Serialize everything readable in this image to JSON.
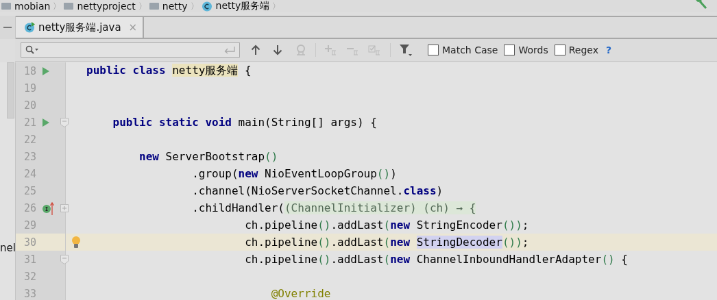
{
  "breadcrumbs": [
    {
      "label": "mobian",
      "kind": "folder",
      "separator": "〉"
    },
    {
      "label": "nettyproject",
      "kind": "folder",
      "separator": "〉"
    },
    {
      "label": "netty",
      "kind": "folder",
      "separator": "〉"
    },
    {
      "label": "netty服务端",
      "kind": "class",
      "separator": "〉"
    }
  ],
  "side_panel_text": "nel",
  "tabs": [
    {
      "label": "netty服务端.java",
      "selected": true,
      "close": "×"
    }
  ],
  "find_bar": {
    "options": [
      {
        "label": "Match Case",
        "checked": false
      },
      {
        "label": "Words",
        "checked": false
      },
      {
        "label": "Regex",
        "checked": false
      }
    ],
    "help": "?"
  },
  "editor": {
    "lines": [
      {
        "number": "18",
        "gutter_icons": [
          {
            "kind": "run"
          }
        ],
        "current": false,
        "segments": [
          {
            "text": "public class ",
            "kind": "kw"
          },
          {
            "text": "netty服务端",
            "kind": "hl"
          },
          {
            "text": " {",
            "kind": "text"
          }
        ]
      },
      {
        "number": "19",
        "current": false
      },
      {
        "number": "20",
        "current": false
      },
      {
        "number": "21",
        "gutter_icons": [
          {
            "kind": "run"
          },
          {
            "kind": "fold"
          }
        ],
        "current": false,
        "segments": [
          {
            "text": "    public static void ",
            "kind": "kw"
          },
          {
            "text": "main(String[] args) {",
            "kind": "text"
          }
        ]
      },
      {
        "number": "22",
        "current": false
      },
      {
        "number": "23",
        "current": false,
        "segments": [
          {
            "text": "        new ",
            "kind": "kw"
          },
          {
            "text": "ServerBootstrap",
            "kind": "text"
          },
          {
            "text": "()",
            "kind": "paren"
          }
        ]
      },
      {
        "number": "24",
        "current": false,
        "segments": [
          {
            "text": "                .group(",
            "kind": "text"
          },
          {
            "text": "new ",
            "kind": "kw"
          },
          {
            "text": "NioEventLoopGroup",
            "kind": "text"
          },
          {
            "text": "()",
            "kind": "paren"
          },
          {
            "text": ")",
            "kind": "text"
          }
        ]
      },
      {
        "number": "25",
        "current": false,
        "segments": [
          {
            "text": "                .channel(NioServerSocketChannel.",
            "kind": "text"
          },
          {
            "text": "class",
            "kind": "kw"
          },
          {
            "text": ")",
            "kind": "text"
          }
        ]
      },
      {
        "number": "26",
        "gutter_icons": [
          {
            "kind": "implement"
          },
          {
            "kind": "expand"
          }
        ],
        "current": false,
        "segments": [
          {
            "text": "                .childHandler(",
            "kind": "text"
          },
          {
            "text": "(ChannelInitializer) (ch) → {",
            "kind": "folded"
          }
        ]
      },
      {
        "number": "29",
        "current": false,
        "segments": [
          {
            "text": "                        ch.pipeline",
            "kind": "text"
          },
          {
            "text": "()",
            "kind": "paren"
          },
          {
            "text": ".addLast",
            "kind": "text"
          },
          {
            "text": "(",
            "kind": "paren"
          },
          {
            "text": "new ",
            "kind": "kw"
          },
          {
            "text": "StringEncoder",
            "kind": "text"
          },
          {
            "text": "())",
            "kind": "paren"
          },
          {
            "text": ";",
            "kind": "text"
          }
        ]
      },
      {
        "number": "30",
        "gutter_icons": [
          {
            "kind": "bulb"
          }
        ],
        "current": true,
        "segments": [
          {
            "text": "                        ch.pipeline",
            "kind": "text"
          },
          {
            "text": "()",
            "kind": "paren"
          },
          {
            "text": ".addLast",
            "kind": "text"
          },
          {
            "text": "(",
            "kind": "paren"
          },
          {
            "text": "new ",
            "kind": "kw"
          },
          {
            "text": "StringDecoder",
            "kind": "usage"
          },
          {
            "text": "())",
            "kind": "paren"
          },
          {
            "text": ";",
            "kind": "text"
          }
        ]
      },
      {
        "number": "31",
        "gutter_icons": [
          {
            "kind": "fold"
          }
        ],
        "current": false,
        "segments": [
          {
            "text": "                        ch.pipeline",
            "kind": "text"
          },
          {
            "text": "()",
            "kind": "paren"
          },
          {
            "text": ".addLast",
            "kind": "text"
          },
          {
            "text": "(",
            "kind": "paren"
          },
          {
            "text": "new ",
            "kind": "kw"
          },
          {
            "text": "ChannelInboundHandlerAdapter",
            "kind": "text"
          },
          {
            "text": "()",
            "kind": "paren"
          },
          {
            "text": " {",
            "kind": "text"
          }
        ]
      },
      {
        "number": "32",
        "current": false
      },
      {
        "number": "33",
        "current": false,
        "segments": [
          {
            "text": "                            @Override",
            "kind": "anno"
          }
        ]
      }
    ]
  }
}
